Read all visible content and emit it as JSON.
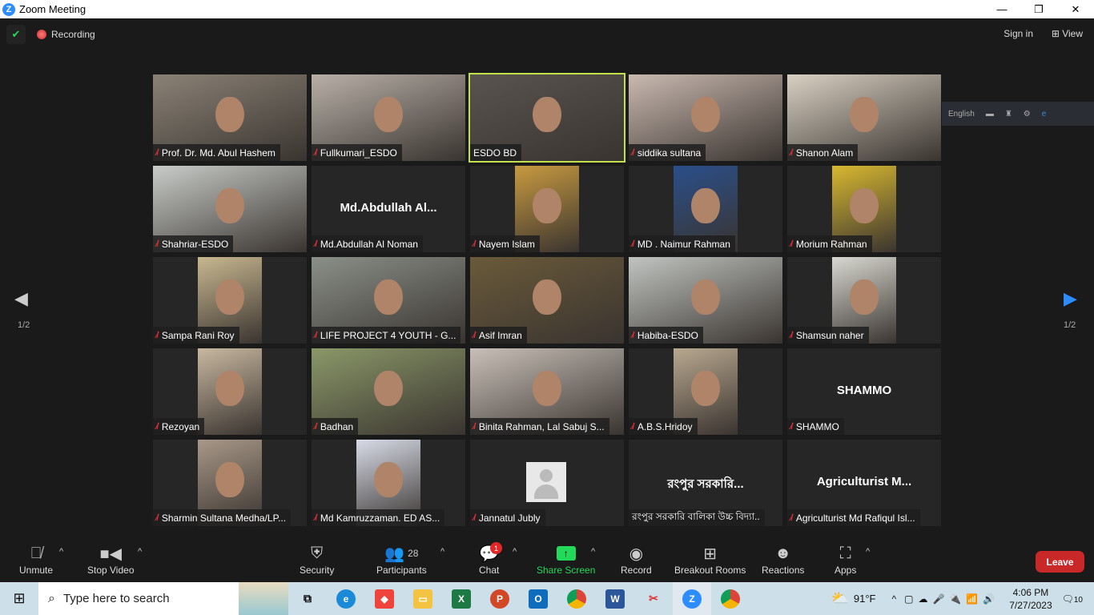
{
  "window": {
    "title": "Zoom Meeting",
    "minimize": "—",
    "maximize": "❐",
    "close": "✕"
  },
  "topbar": {
    "recording": "Recording",
    "sign_in": "Sign in",
    "view": "View"
  },
  "language_bar": {
    "language": "English"
  },
  "pagination": {
    "left": "1/2",
    "right": "1/2"
  },
  "tiles": [
    {
      "name": "Prof. Dr. Md. Abul Hashem",
      "type": "full",
      "bg": "#8a8276",
      "muted": true
    },
    {
      "name": "Fullkumari_ESDO",
      "type": "full",
      "bg": "#b8b0a8",
      "muted": true
    },
    {
      "name": "ESDO BD",
      "type": "full",
      "bg": "#5a5450",
      "muted": false,
      "active": true
    },
    {
      "name": "siddika sultana",
      "type": "full",
      "bg": "#c9b9b0",
      "muted": true
    },
    {
      "name": "Shanon Alam",
      "type": "full",
      "bg": "#d8d0c2",
      "muted": true
    },
    {
      "name": "Shahriar-ESDO",
      "type": "full",
      "bg": "#c8ccc8",
      "muted": true
    },
    {
      "name": "Md.Abdullah Al Noman",
      "type": "name",
      "display": "Md.Abdullah  Al...",
      "muted": true
    },
    {
      "name": "Nayem Islam",
      "type": "portrait",
      "bg": "#c89a40",
      "muted": true
    },
    {
      "name": "MD . Naimur Rahman",
      "type": "portrait",
      "bg": "#2a4f8a",
      "muted": true
    },
    {
      "name": "Morium Rahman",
      "type": "portrait",
      "bg": "#d8b830",
      "muted": true
    },
    {
      "name": "Sampa Rani Roy",
      "type": "portrait",
      "bg": "#c8b890",
      "muted": true
    },
    {
      "name": "LIFE PROJECT 4 YOUTH - G...",
      "type": "full",
      "bg": "#8a9088",
      "muted": true
    },
    {
      "name": "Asif Imran",
      "type": "full",
      "bg": "#6a5a3a",
      "muted": true
    },
    {
      "name": "Habiba-ESDO",
      "type": "full",
      "bg": "#c0c4c0",
      "muted": true
    },
    {
      "name": "Shamsun naher",
      "type": "portrait",
      "bg": "#d8d8d0",
      "muted": true
    },
    {
      "name": "Rezoyan",
      "type": "portrait",
      "bg": "#c8b8a0",
      "muted": true
    },
    {
      "name": "Badhan",
      "type": "full",
      "bg": "#8a9868",
      "muted": true
    },
    {
      "name": "Binita Rahman, Lal Sabuj S...",
      "type": "full",
      "bg": "#c8c0b8",
      "muted": true
    },
    {
      "name": "A.B.S.Hridoy",
      "type": "portrait",
      "bg": "#b8a890",
      "muted": true
    },
    {
      "name": "SHAMMO",
      "type": "name",
      "display": "SHAMMO",
      "muted": true
    },
    {
      "name": "Sharmin Sultana Medha/LP...",
      "type": "portrait",
      "bg": "#a89888",
      "muted": true
    },
    {
      "name": "Md Kamruzzaman.  ED AS...",
      "type": "portrait",
      "bg": "#d8dce8",
      "muted": true
    },
    {
      "name": "Jannatul Jubly",
      "type": "avatar",
      "muted": true
    },
    {
      "name": "রংপুর সরকারি বালিকা উচ্চ বিদ্যা..",
      "type": "name",
      "display": "রংপুর সরকারি...",
      "muted": false
    },
    {
      "name": "Agriculturist Md Rafiqul Isl...",
      "type": "name",
      "display": "Agriculturist  M...",
      "muted": true
    }
  ],
  "toolbar": {
    "unmute": "Unmute",
    "stop_video": "Stop Video",
    "security": "Security",
    "participants": "Participants",
    "participants_count": "28",
    "chat": "Chat",
    "chat_badge": "1",
    "share_screen": "Share Screen",
    "record": "Record",
    "breakout": "Breakout Rooms",
    "reactions": "Reactions",
    "apps": "Apps",
    "leave": "Leave"
  },
  "taskbar": {
    "search_placeholder": "Type here to search",
    "weather": "91°F",
    "time": "4:06 PM",
    "date": "7/27/2023",
    "notifications": "10"
  },
  "colors": {
    "accent": "#2d8cff",
    "leave": "#c82828",
    "share": "#23d959",
    "active_border": "#c2e04a"
  }
}
